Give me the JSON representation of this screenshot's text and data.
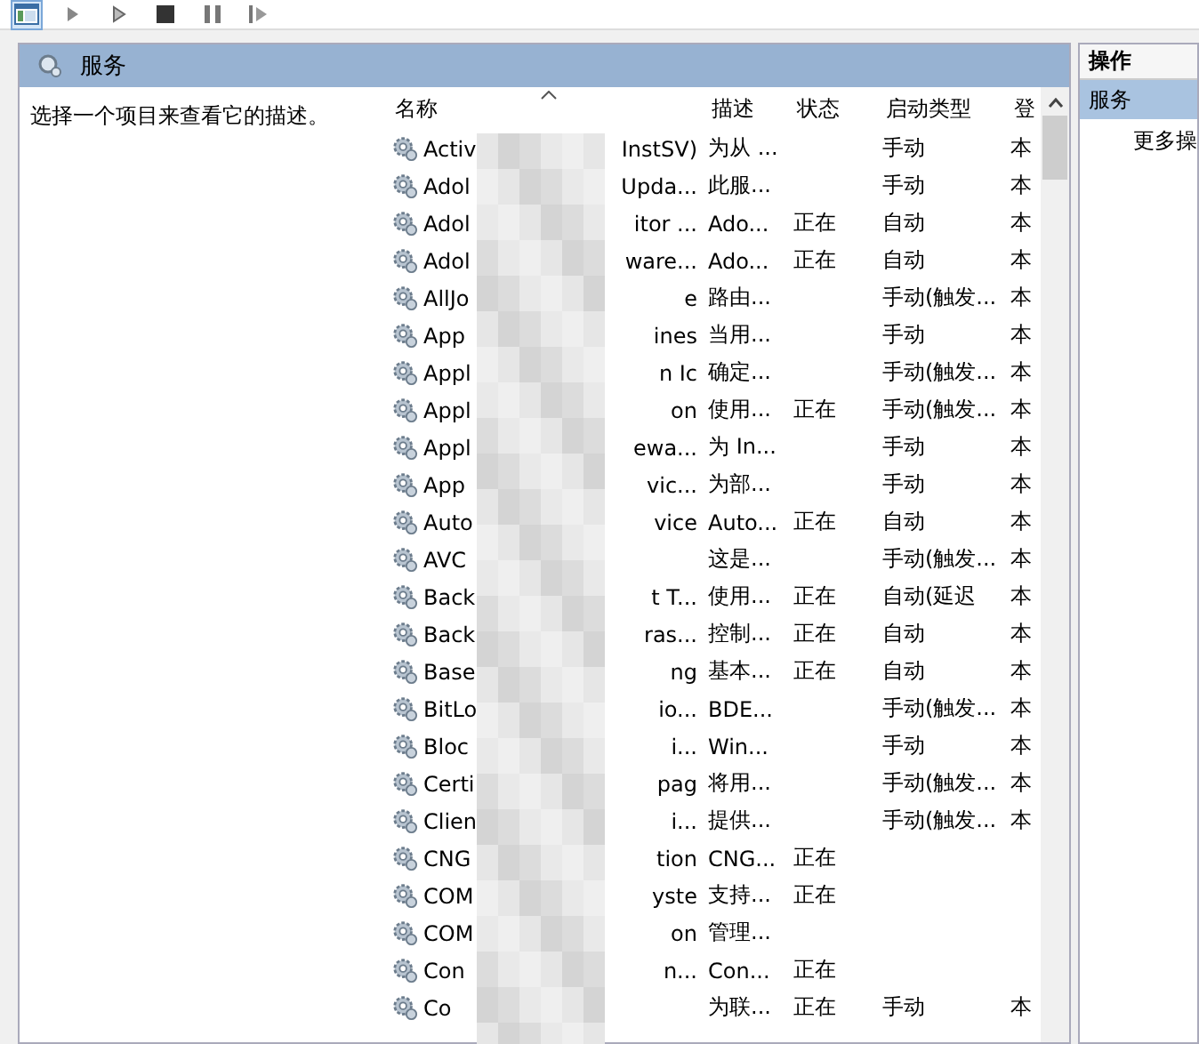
{
  "toolbar": {
    "buttons": [
      {
        "kind": "view",
        "selected": true
      },
      {
        "kind": "play"
      },
      {
        "kind": "play-outline"
      },
      {
        "kind": "stop"
      },
      {
        "kind": "pause"
      },
      {
        "kind": "resume"
      }
    ]
  },
  "panel": {
    "title": "服务",
    "description": "选择一个项目来查看它的描述。"
  },
  "table": {
    "columns": [
      "名称",
      "描述",
      "状态",
      "启动类型",
      "登"
    ],
    "rows": [
      {
        "name": "Activ",
        "name_end": "InstSV)",
        "description": "为从 ...",
        "status": "",
        "startup": "手动",
        "logon": "本"
      },
      {
        "name": "Adol",
        "name_end": "Upda...",
        "description": "此服...",
        "status": "",
        "startup": "手动",
        "logon": "本"
      },
      {
        "name": "Adol",
        "name_end": "itor ...",
        "description": "Ado...",
        "status": "正在",
        "startup": "自动",
        "logon": "本"
      },
      {
        "name": "Adol",
        "name_end": "ware...",
        "description": "Ado...",
        "status": "正在",
        "startup": "自动",
        "logon": "本"
      },
      {
        "name": "AllJo",
        "name_end": "e",
        "description": "路由...",
        "status": "",
        "startup": "手动(触发...",
        "logon": "本"
      },
      {
        "name": "App",
        "name_end": "ines",
        "description": "当用...",
        "status": "",
        "startup": "手动",
        "logon": "本"
      },
      {
        "name": "Appl",
        "name_end": "n Ic",
        "description": "确定...",
        "status": "",
        "startup": "手动(触发...",
        "logon": "本"
      },
      {
        "name": "Appl",
        "name_end": "on",
        "description": "使用...",
        "status": "正在",
        "startup": "手动(触发...",
        "logon": "本"
      },
      {
        "name": "Appl",
        "name_end": "ewa...",
        "description": "为 In...",
        "status": "",
        "startup": "手动",
        "logon": "本"
      },
      {
        "name": "App",
        "name_end": "vic...",
        "description": "为部...",
        "status": "",
        "startup": "手动",
        "logon": "本"
      },
      {
        "name": "Auto",
        "name_end": "vice",
        "description": "Auto...",
        "status": "正在",
        "startup": "自动",
        "logon": "本"
      },
      {
        "name": "AVC",
        "name_end": "",
        "description": "这是...",
        "status": "",
        "startup": "手动(触发...",
        "logon": "本"
      },
      {
        "name": "Back",
        "name_end": "t T...",
        "description": "使用...",
        "status": "正在",
        "startup": "自动(延迟",
        "logon": "本"
      },
      {
        "name": "Back",
        "name_end": "ras...",
        "description": "控制...",
        "status": "正在",
        "startup": "自动",
        "logon": "本"
      },
      {
        "name": "Base",
        "name_end": "ng",
        "description": "基本...",
        "status": "正在",
        "startup": "自动",
        "logon": "本"
      },
      {
        "name": "BitLo",
        "name_end": "io...",
        "description": "BDE...",
        "status": "",
        "startup": "手动(触发...",
        "logon": "本"
      },
      {
        "name": "Bloc",
        "name_end": "i...",
        "description": "Win...",
        "status": "",
        "startup": "手动",
        "logon": "本"
      },
      {
        "name": "Certi",
        "name_end": "pag",
        "description": "将用...",
        "status": "",
        "startup": "手动(触发...",
        "logon": "本"
      },
      {
        "name": "Clien",
        "name_end": "i...",
        "description": "提供...",
        "status": "",
        "startup": "手动(触发...",
        "logon": "本"
      },
      {
        "name": "CNG",
        "name_end": "tion",
        "description": "CNG...",
        "status": "正在",
        "startup": "",
        "logon": ""
      },
      {
        "name": "COM",
        "name_end": "yste",
        "description": "支持...",
        "status": "正在",
        "startup": "",
        "logon": ""
      },
      {
        "name": "COM",
        "name_end": "on",
        "description": "管理...",
        "status": "",
        "startup": "",
        "logon": ""
      },
      {
        "name": "Con",
        "name_end": "n...",
        "description": "Con...",
        "status": "正在",
        "startup": "",
        "logon": ""
      },
      {
        "name": "Co",
        "name_end": "",
        "description": "为联...",
        "status": "正在",
        "startup": "手动",
        "logon": "本"
      }
    ]
  },
  "actions": {
    "title": "操作",
    "section": "服务",
    "items": [
      "更多操"
    ]
  }
}
